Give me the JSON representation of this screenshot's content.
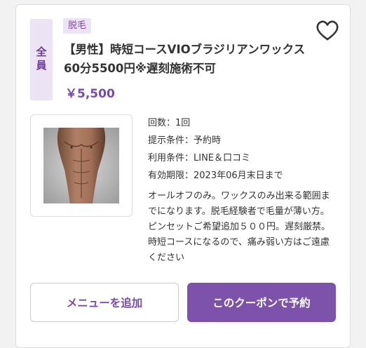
{
  "coupon": {
    "target": "全員",
    "category": "脱毛",
    "title": "【男性】時短コースVIOブラジリアンワックス60分5500円※遅刻施術不可",
    "price": "￥5,500",
    "favorite_icon": "heart-outline-icon",
    "conditions": {
      "visits": "回数：1回",
      "present": "提示条件：予約時",
      "usage": "利用条件：LINE＆口コミ",
      "expiry": "有効期限：2023年06月末日まで"
    },
    "description": "オールオフのみ。ワックスのみ出来る範囲までになります。脱毛経験者で毛量が薄い方。ピンセットご希望追加５００円。遅刻厳禁。時短コースになるので、痛み弱い方はご遠慮ください",
    "buttons": {
      "add_menu": "メニューを追加",
      "reserve": "このクーポンで予約"
    }
  },
  "colors": {
    "accent": "#7d52ab",
    "badge_bg": "#ece3f5"
  }
}
